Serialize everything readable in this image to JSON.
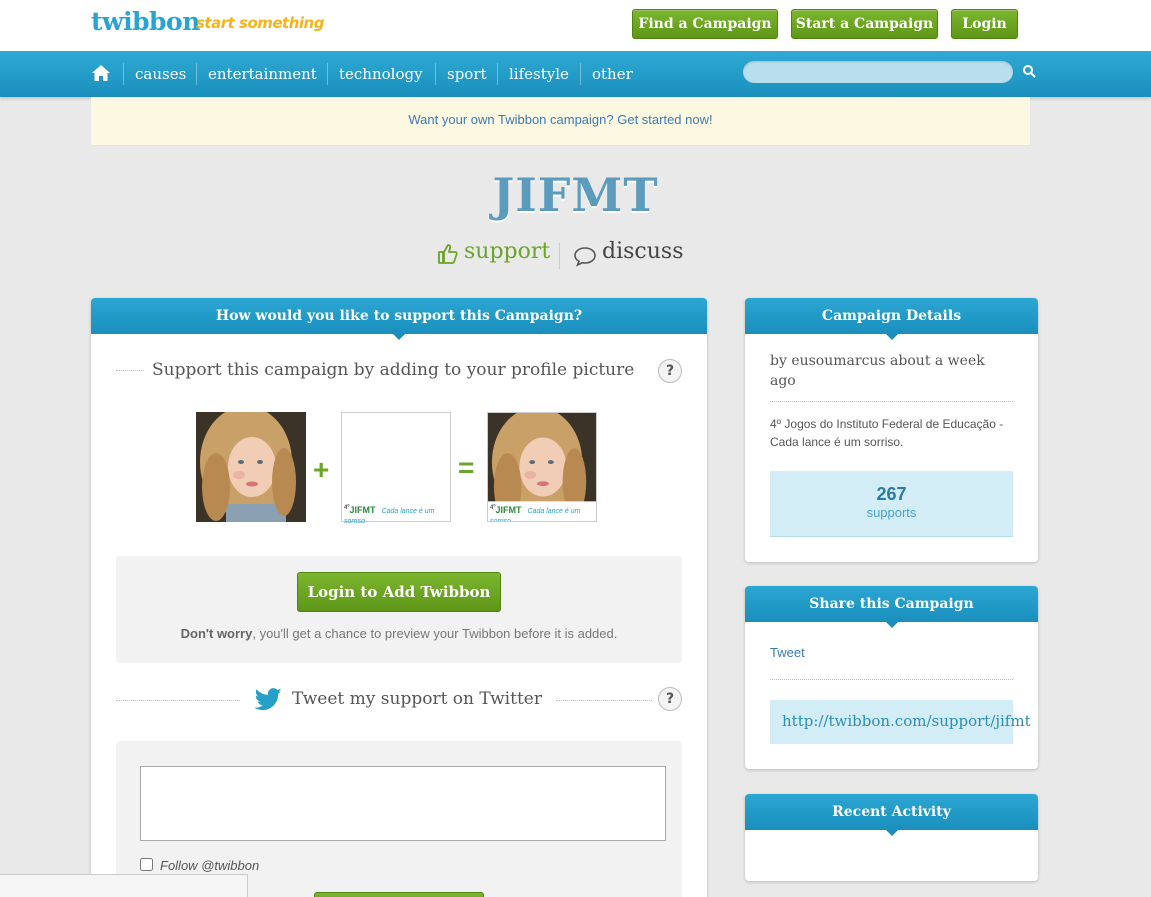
{
  "header": {
    "logo": "twibbon",
    "tagline": "start something",
    "find_campaign": "Find a Campaign",
    "start_campaign": "Start a Campaign",
    "login": "Login"
  },
  "nav": {
    "items": [
      "causes",
      "entertainment",
      "technology",
      "sport",
      "lifestyle",
      "other"
    ],
    "search_placeholder": ""
  },
  "notice": "Want your own Twibbon campaign? Get started now!",
  "campaign": {
    "title": "JIFMT",
    "support_label": "support",
    "discuss_label": "discuss"
  },
  "support_panel": {
    "header": "How would you like to support this Campaign?",
    "profile_section_title": "Support this campaign by adding to your profile picture",
    "help_label": "?",
    "twibbon_overlay_text": "JIFMT",
    "twibbon_overlay_superscript": "4º",
    "twibbon_overlay_script": "Cada lance é um sorriso",
    "plus": "+",
    "equals": "=",
    "login_button": "Login to Add Twibbon",
    "dont_worry_bold": "Don't worry",
    "dont_worry_rest": ", you'll get a chance to preview your Twibbon before it is added.",
    "tweet_section_title": "Tweet my support on Twitter",
    "tweet_text_value": "",
    "follow_label": "Follow @twibbon"
  },
  "details_panel": {
    "header": "Campaign Details",
    "byline": "by eusoumarcus about a week ago",
    "description": "4º Jogos do Instituto Federal de Educação - Cada lance é um sorriso.",
    "supports_count": "267",
    "supports_label": "supports"
  },
  "share_panel": {
    "header": "Share this Campaign",
    "tweet_link": "Tweet",
    "url": "http://twibbon.com/support/jifmt"
  },
  "activity_panel": {
    "header": "Recent Activity"
  },
  "colors": {
    "brand_blue": "#1a8fbd",
    "green": "#6aa428",
    "title_blue": "#5b9bbc"
  }
}
